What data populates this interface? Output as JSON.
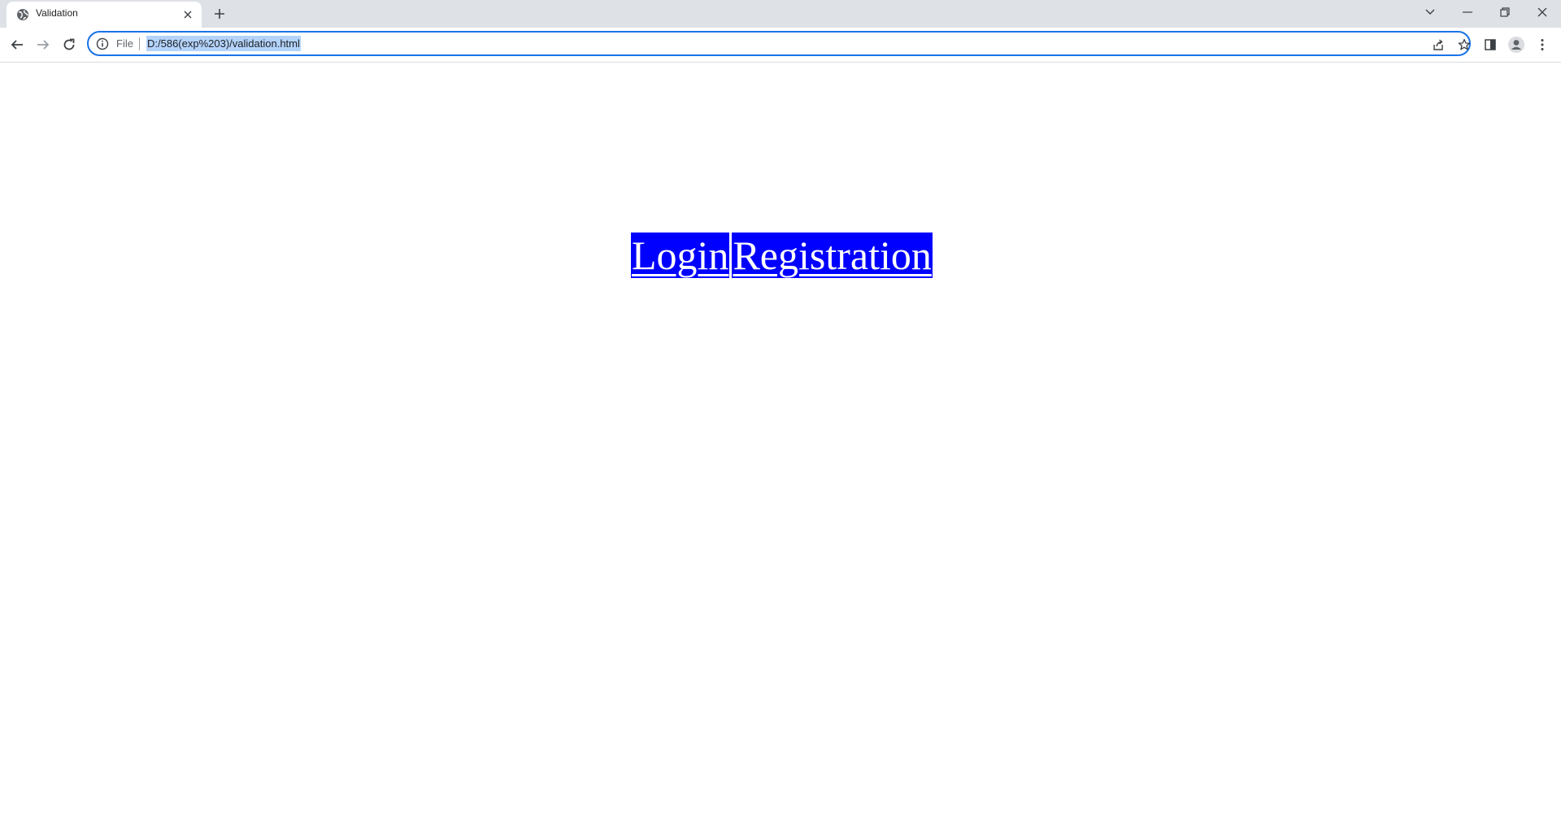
{
  "browser": {
    "tab": {
      "title": "Validation",
      "icon": "globe-icon"
    },
    "newtab_icon": "plus-icon",
    "window_controls": [
      "tab-search-icon",
      "minimize-icon",
      "restore-icon",
      "close-icon"
    ],
    "toolbar": {
      "back_icon": "back-arrow-icon",
      "forward_icon": "forward-arrow-icon",
      "reload_icon": "reload-icon",
      "omnibox": {
        "info_icon": "info-icon",
        "scheme_label": "File",
        "url": "D:/586(exp%203)/validation.html",
        "url_selected": true,
        "share_icon": "share-icon",
        "bookmark_icon": "star-icon"
      },
      "side_panel_icon": "side-panel-icon",
      "profile_icon": "profile-avatar-icon",
      "menu_icon": "kebab-menu-icon"
    },
    "colors": {
      "accent": "#1a73e8",
      "selection": "#b3d3fb",
      "tabstrip": "#dee1e6"
    }
  },
  "page": {
    "links": [
      {
        "label": "Login"
      },
      {
        "label": "Registration"
      }
    ],
    "colors": {
      "link_background": "#0000ff",
      "link_text": "#ffffff"
    }
  }
}
